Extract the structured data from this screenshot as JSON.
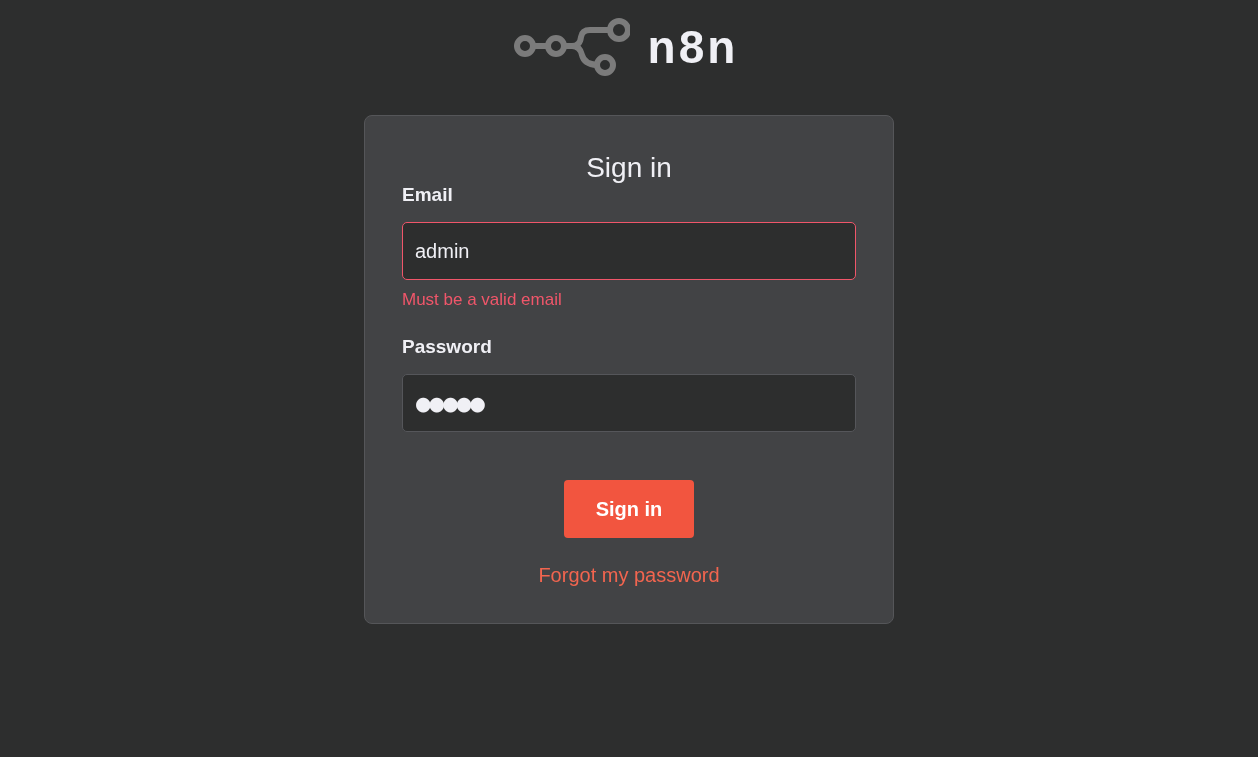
{
  "logo": {
    "text": "n8n"
  },
  "card": {
    "title": "Sign in",
    "fields": [
      {
        "kind": "email",
        "label": "Email",
        "value": "admin",
        "invalid": true,
        "error": "Must be a valid email"
      },
      {
        "kind": "password",
        "label": "Password",
        "value": "●●●●●",
        "invalid": false
      }
    ],
    "button": "Sign in",
    "link": "Forgot my password"
  }
}
